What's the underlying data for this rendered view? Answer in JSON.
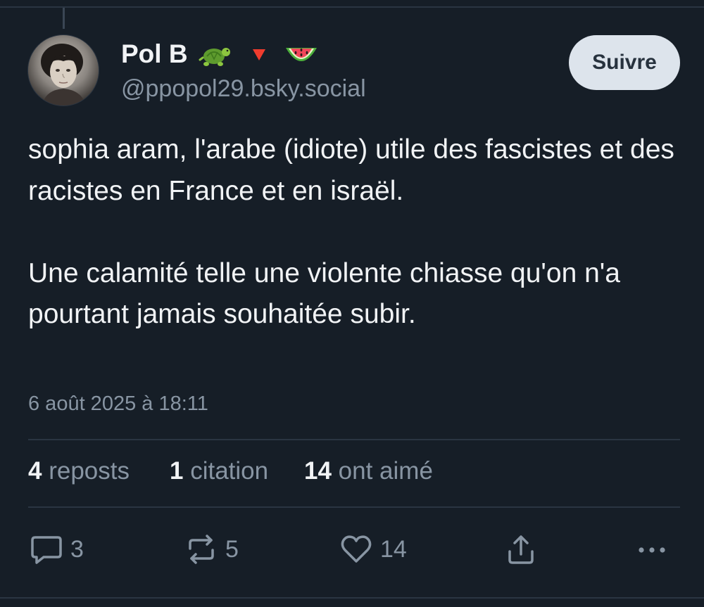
{
  "author": {
    "display_name": "Pol B",
    "handle": "@ppopol29.bsky.social",
    "emojis": [
      "turtle-emoji",
      "red-triangle-emoji",
      "watermelon-emoji"
    ]
  },
  "follow_button": {
    "label": "Suivre"
  },
  "post": {
    "paragraphs": [
      "sophia aram, l'arabe (idiote) utile des fascistes et des racistes en France et en israël.",
      "Une calamité telle une violente chiasse qu'on n'a pourtant jamais souhaitée subir."
    ],
    "timestamp": "6 août 2025 à 18:11"
  },
  "stats": {
    "reposts": {
      "count": "4",
      "label": "reposts"
    },
    "quotes": {
      "count": "1",
      "label": "citation"
    },
    "likes": {
      "count": "14",
      "label": "ont aimé"
    }
  },
  "actions": {
    "reply": {
      "icon": "comment-icon",
      "count": "3"
    },
    "repost": {
      "icon": "repost-icon",
      "count": "5"
    },
    "like": {
      "icon": "heart-icon",
      "count": "14"
    },
    "share": {
      "icon": "share-icon"
    },
    "more": {
      "icon": "more-icon"
    }
  },
  "colors": {
    "background": "#161e27",
    "text": "#f1f3f5",
    "muted": "#8895a3",
    "divider": "#2a3542",
    "button_bg": "#dde4ec",
    "button_text": "#27323e"
  }
}
